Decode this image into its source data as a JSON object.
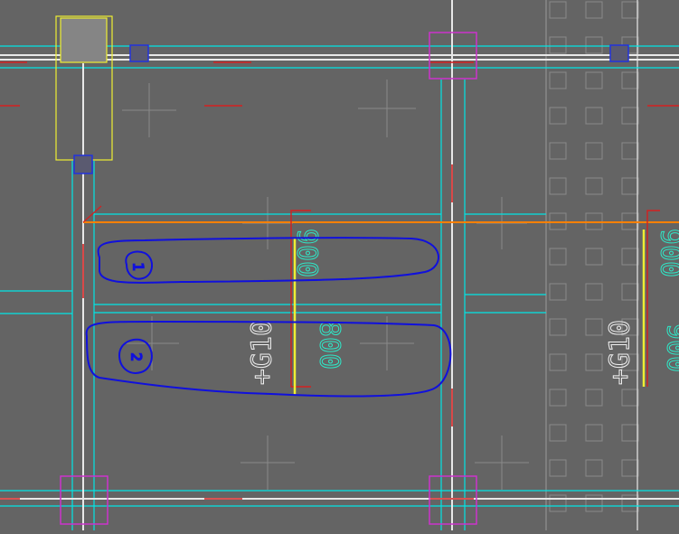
{
  "drawing": {
    "colors": {
      "background": "#646464",
      "wall_line": "#00e5e5",
      "beam": "#e8e8e8",
      "axis": "#d42020",
      "column_box": "#cc33cc",
      "selection": "#eeee33",
      "section_line": "#ff8000",
      "marker": "#2233dd",
      "markup": "#1010dd",
      "label_white": "#f0f0f0",
      "label_cyan": "#2ee8c8",
      "grid_square": "#8a8a8a"
    },
    "labels": {
      "width_upper": "900",
      "width_lower": "800",
      "width_right_top": "900",
      "width_right_bottom": "900",
      "elev_left": "+G10",
      "elev_right": "+G10"
    },
    "markups": {
      "upper_note": "1",
      "lower_note": "2"
    }
  }
}
